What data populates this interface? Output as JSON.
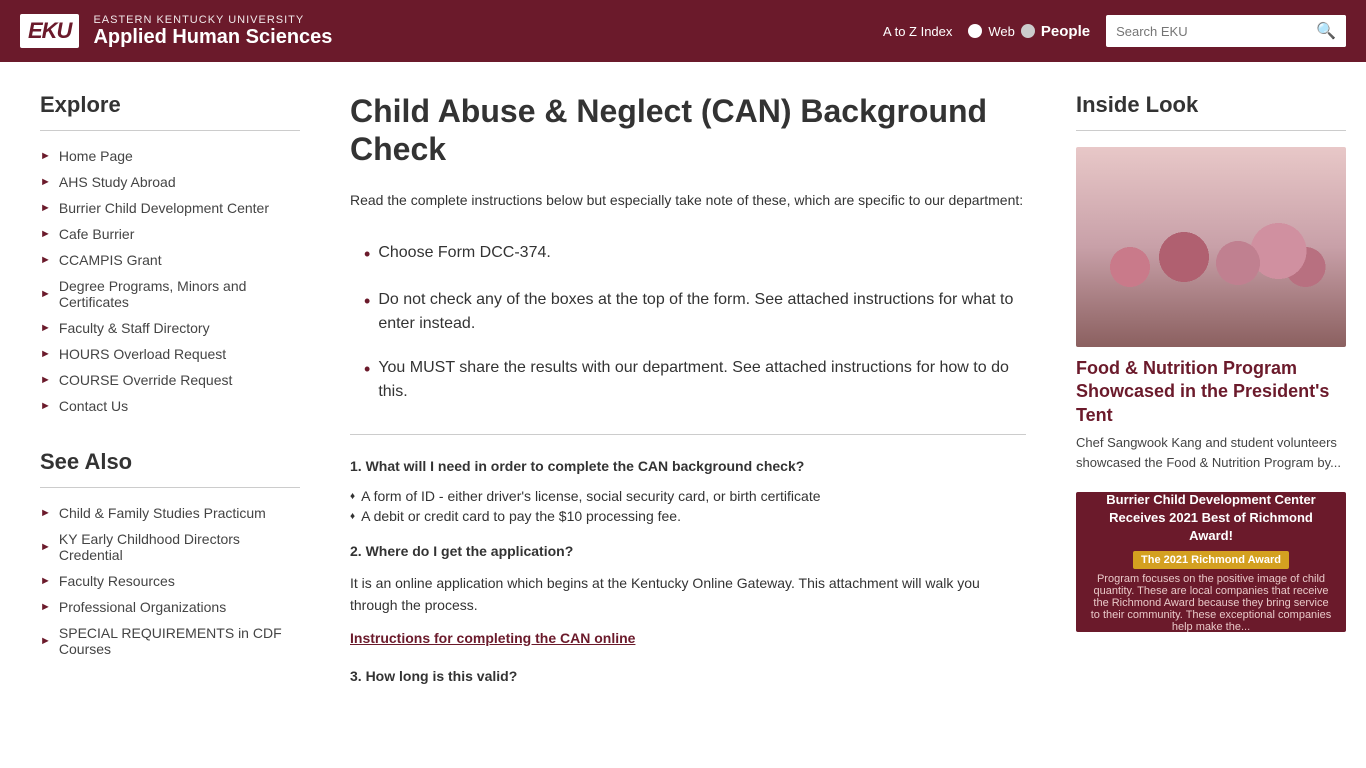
{
  "header": {
    "logo": "EKU",
    "university": "EASTERN KENTUCKY UNIVERSITY",
    "department": "Applied Human Sciences",
    "nav": {
      "a_to_z": "A to Z Index",
      "web_label": "Web",
      "people_label": "People"
    },
    "search_placeholder": "Search EKU"
  },
  "sidebar": {
    "explore_heading": "Explore",
    "nav_items": [
      {
        "label": "Home Page"
      },
      {
        "label": "AHS Study Abroad"
      },
      {
        "label": "Burrier Child Development Center"
      },
      {
        "label": "Cafe Burrier"
      },
      {
        "label": "CCAMPIS Grant"
      },
      {
        "label": "Degree Programs, Minors and Certificates"
      },
      {
        "label": "Faculty & Staff Directory"
      },
      {
        "label": "HOURS Overload Request"
      },
      {
        "label": "COURSE Override Request"
      },
      {
        "label": "Contact Us"
      }
    ],
    "see_also_heading": "See Also",
    "see_also_items": [
      {
        "label": "Child & Family Studies Practicum"
      },
      {
        "label": "KY Early Childhood Directors Credential"
      },
      {
        "label": "Faculty Resources"
      },
      {
        "label": "Professional Organizations"
      },
      {
        "label": "SPECIAL REQUIREMENTS in CDF Courses"
      }
    ]
  },
  "main": {
    "title": "Child Abuse & Neglect (CAN) Background Check",
    "intro": "Read the complete instructions below but especially take note of these, which are specific to our department:",
    "highlights": [
      "Choose Form DCC-374.",
      "Do not check any of the boxes at the top of the form.  See attached instructions for what to enter instead.",
      "You MUST share the results with our department.  See attached instructions for how to do this."
    ],
    "faq": [
      {
        "question": "1.  What will I need in order to complete the CAN background check?",
        "bullets": [
          "A form of ID - either driver's license, social security card, or birth certificate",
          "A debit or credit card to pay the $10 processing fee."
        ],
        "body": ""
      },
      {
        "question": "2.  Where do I get the application?",
        "body": "It is an online application which begins at the Kentucky Online Gateway. This attachment will walk you through the process.",
        "link_text": "Instructions for completing the CAN online",
        "link": "#"
      },
      {
        "question": "3.  How long is this valid?",
        "body": ""
      }
    ]
  },
  "right_sidebar": {
    "heading": "Inside Look",
    "card1": {
      "title": "Food & Nutrition Program Showcased in the President's Tent",
      "desc": "Chef Sangwook Kang and student volunteers showcased the Food & Nutrition Program by..."
    },
    "card2": {
      "title": "Burrier Child Development Center Receives 2021 Best of Richmond Award!",
      "badge": "The 2021 Richmond Award",
      "sub": "Program focuses on the positive image of child quantity. These are local companies that receive the Richmond Award because they bring service to their community. These exceptional companies help make the..."
    }
  }
}
